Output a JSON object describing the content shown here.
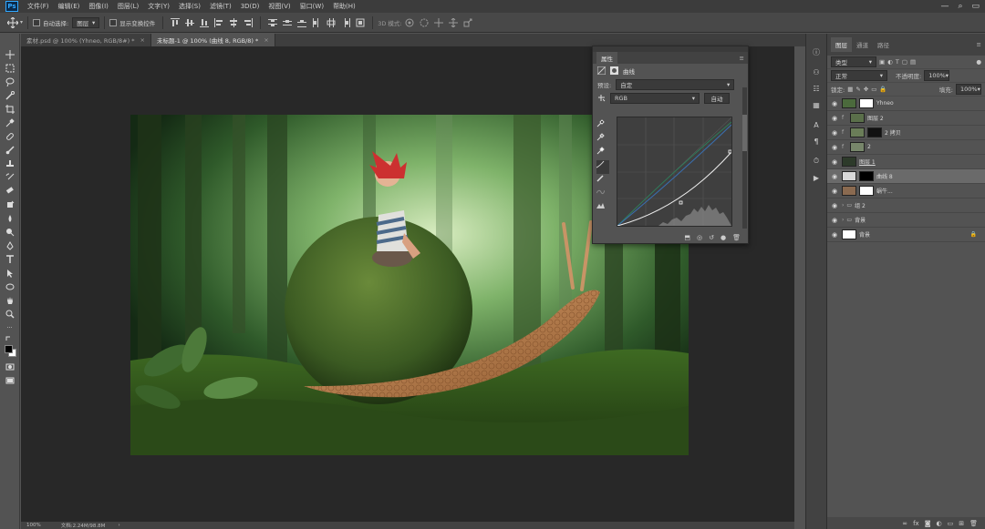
{
  "app": {
    "logo": "Ps"
  },
  "menu": [
    "文件(F)",
    "编辑(E)",
    "图像(I)",
    "图层(L)",
    "文字(Y)",
    "选择(S)",
    "滤镜(T)",
    "3D(D)",
    "视图(V)",
    "窗口(W)",
    "帮助(H)"
  ],
  "options": {
    "auto_select_label": "自动选择:",
    "auto_select_value": "图层",
    "show_transform_label": "显示变换控件"
  },
  "tabs": [
    {
      "label": "素材.psd @ 100% (Yhneo, RGB/8#) *",
      "active": false
    },
    {
      "label": "未标题-1 @ 100% (曲线 8, RGB/8) *",
      "active": true
    }
  ],
  "status": {
    "zoom": "100%",
    "doc": "文档:2.24M/98.8M"
  },
  "properties": {
    "title": "属性",
    "panel_name": "曲线",
    "preset_label": "预设:",
    "preset_value": "自定",
    "channel_value": "RGB",
    "auto_button": "自动"
  },
  "layers_panel": {
    "tabs": [
      "图层",
      "通道",
      "路径"
    ],
    "filter_kind": "类型",
    "blend_mode": "正常",
    "opacity_label": "不透明度:",
    "opacity_value": "100%",
    "lock_label": "锁定:",
    "fill_label": "填充:",
    "fill_value": "100%",
    "layers": [
      {
        "name": "Yhneo",
        "indent": false,
        "thumb": "#4b6a3c",
        "mask": "#ffffff",
        "selected": false,
        "fx": ""
      },
      {
        "name": "图层 2",
        "indent": true,
        "thumb": "#5a6f4a",
        "mask": "",
        "selected": false,
        "fx": "f"
      },
      {
        "name": "2 拷贝",
        "indent": true,
        "thumb": "#6a7d58",
        "mask": "#111111",
        "selected": false,
        "fx": "f"
      },
      {
        "name": "2",
        "indent": true,
        "thumb": "#77866a",
        "mask": "",
        "selected": false,
        "fx": "f"
      },
      {
        "name": "图层 1",
        "indent": false,
        "thumb": "#2d3a2a",
        "mask": "",
        "selected": false,
        "fx": ""
      },
      {
        "name": "曲线 8",
        "indent": false,
        "thumb": "#d8d8d8",
        "mask": "#000000",
        "selected": true,
        "fx": ""
      },
      {
        "name": "蜗牛...",
        "indent": false,
        "thumb": "#8a6a50",
        "mask": "#ffffff",
        "selected": false,
        "fx": ""
      },
      {
        "name": "组 2",
        "indent": false,
        "thumb": "",
        "mask": "",
        "selected": false,
        "fx": ""
      },
      {
        "name": "背景",
        "indent": false,
        "thumb": "",
        "mask": "",
        "selected": false,
        "fx": ""
      },
      {
        "name": "背景",
        "indent": false,
        "thumb": "#ffffff",
        "mask": "",
        "selected": false,
        "fx": ""
      }
    ]
  }
}
